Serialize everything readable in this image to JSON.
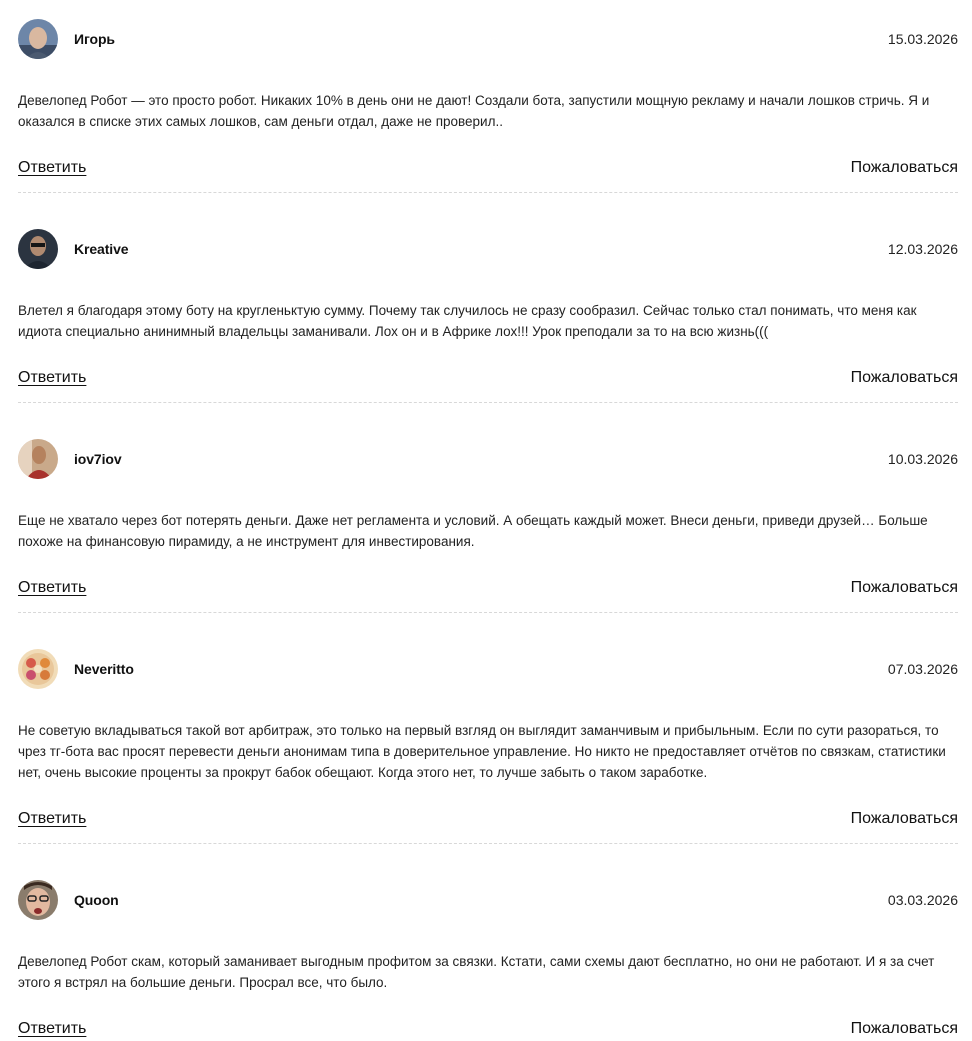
{
  "comments": [
    {
      "author": "Игорь",
      "date": "15.03.2026",
      "text": "Девелопед Робот — это просто робот. Никаких 10% в день они не дают! Создали бота, запустили мощную рекламу и начали лошков стричь. Я и оказался в списке этих самых лошков, сам деньги отдал, даже не проверил..",
      "reply_label": "Ответить",
      "report_label": "Пожаловаться",
      "avatar_icon": "avatar-photo"
    },
    {
      "author": "Kreative",
      "date": "12.03.2026",
      "text": "Влетел я благодаря этому боту на кругленьктую сумму. Почему так случилось не сразу сообразил. Сейчас только стал понимать, что меня как идиота специально анинимный владельцы заманивали. Лох он и в Африке лох!!! Урок преподали за то на всю жизнь(((",
      "reply_label": "Ответить",
      "report_label": "Пожаловаться",
      "avatar_icon": "avatar-photo"
    },
    {
      "author": "iov7iov",
      "date": "10.03.2026",
      "text": "Еще не хватало через бот потерять деньги. Даже нет регламента и условий. А обещать каждый может. Внеси деньги, приведи друзей… Больше похоже на финансовую пирамиду, а не инструмент для инвестирования.",
      "reply_label": "Ответить",
      "report_label": "Пожаловаться",
      "avatar_icon": "avatar-photo"
    },
    {
      "author": "Neveritto",
      "date": "07.03.2026",
      "text": "Не советую вкладываться такой вот арбитраж, это только на первый взгляд он выглядит заманчивым и прибыльным. Если по сути разораться, то чрез тг-бота вас просят перевести деньги анонимам типа в доверительное управление. Но никто не предоставляет отчётов по связкам, статистики нет, очень высокие проценты за прокрут бабок обещают. Когда этого нет, то лучше забыть о таком заработке.",
      "reply_label": "Ответить",
      "report_label": "Пожаловаться",
      "avatar_icon": "avatar-illustration"
    },
    {
      "author": "Quoon",
      "date": "03.03.2026",
      "text": "Девелопед Робот скам, который заманивает выгодным профитом за связки. Кстати, сами схемы дают бесплатно, но они не работают. И я за счет этого я встрял на большие деньги. Просрал все, что было.",
      "reply_label": "Ответить",
      "report_label": "Пожаловаться",
      "avatar_icon": "avatar-photo"
    }
  ]
}
